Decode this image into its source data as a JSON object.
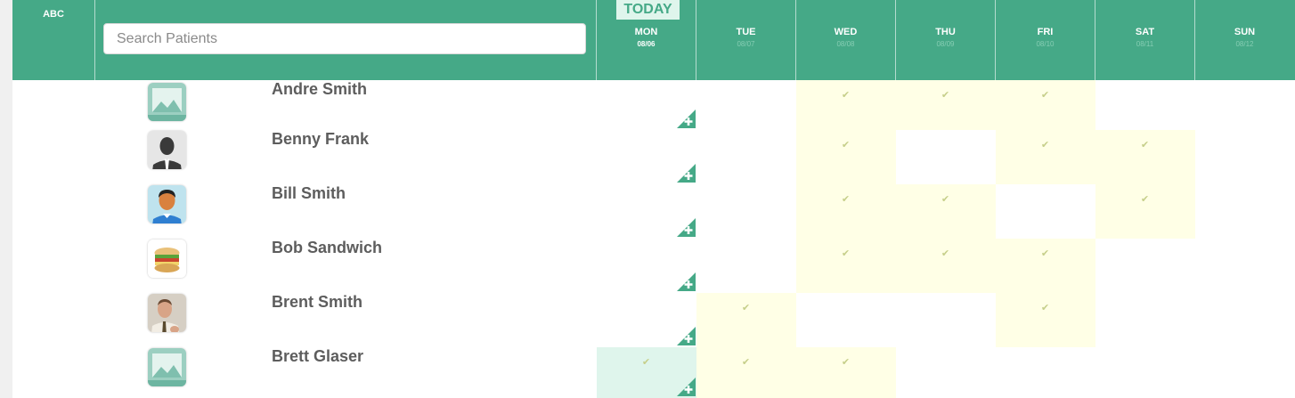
{
  "header": {
    "abc_label": "ABC",
    "today_badge": "TODAY",
    "search": {
      "placeholder": "Search Patients",
      "value": ""
    },
    "days": [
      {
        "name": "MON",
        "date": "08/06",
        "is_today": true
      },
      {
        "name": "TUE",
        "date": "08/07",
        "is_today": false
      },
      {
        "name": "WED",
        "date": "08/08",
        "is_today": false
      },
      {
        "name": "THU",
        "date": "08/09",
        "is_today": false
      },
      {
        "name": "FRI",
        "date": "08/10",
        "is_today": false
      },
      {
        "name": "SAT",
        "date": "08/11",
        "is_today": false
      },
      {
        "name": "SUN",
        "date": "08/12",
        "is_today": false
      }
    ]
  },
  "patients": [
    {
      "name": "Andre Smith",
      "avatar": "image-placeholder-icon",
      "checked_days": [
        "WED",
        "THU",
        "FRI"
      ]
    },
    {
      "name": "Benny Frank",
      "avatar": "person-silhouette-icon",
      "checked_days": [
        "WED",
        "FRI",
        "SAT"
      ]
    },
    {
      "name": "Bill Smith",
      "avatar": "cartoon-man-icon",
      "checked_days": [
        "WED",
        "THU",
        "SAT"
      ]
    },
    {
      "name": "Bob Sandwich",
      "avatar": "sandwich-icon",
      "checked_days": [
        "WED",
        "THU",
        "FRI"
      ]
    },
    {
      "name": "Brent Smith",
      "avatar": "man-photo-icon",
      "checked_days": [
        "TUE",
        "FRI"
      ]
    },
    {
      "name": "Brett Glaser",
      "avatar": "image-placeholder-icon",
      "checked_days": [
        "MON",
        "TUE",
        "WED"
      ]
    }
  ],
  "colors": {
    "header": "#45a987",
    "checked_cell": "#ffffe6",
    "today_checked_cell": "#dff5ec",
    "check_mark": "#c6cf8a",
    "patient_name": "#5d5d5d"
  },
  "icons": {
    "check": "✔",
    "add": "add-visit-icon"
  }
}
